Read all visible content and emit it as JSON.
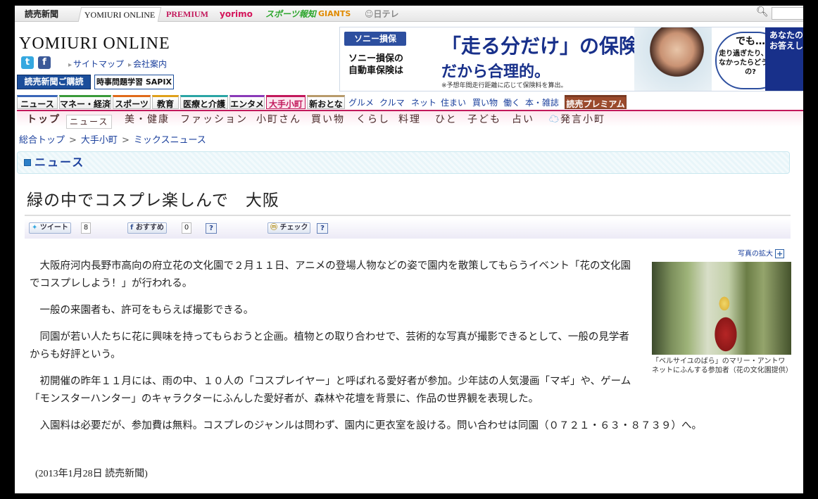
{
  "brand_tabs": [
    "読売新聞",
    "YOMIURI ONLINE",
    "PREMIUM",
    "yorimo",
    "スポーツ報知",
    "GIANTS",
    "日テレ"
  ],
  "header": {
    "logo": "YOMIURI ONLINE",
    "links": [
      "サイトマップ",
      "会社案内"
    ],
    "paper_button": "読売新聞ご購読",
    "sapix_button": "時事問題学習 SAPIX"
  },
  "ad": {
    "logo": "ソニー損保",
    "sub": "ソニー損保の\n自動車保険は",
    "headline": "「走る分だけ」の保険料!",
    "headline2": "だから合理的。",
    "note": "※予想年間走行距離に応じて保険料を算出。",
    "bubble_title": "でも…",
    "bubble_text": "走り過ぎたり、走らなかったらどうなるの?",
    "right": "あなたのお答えし"
  },
  "nav": {
    "tabs": [
      "ニュース",
      "マネー・経済",
      "スポーツ",
      "教育",
      "医療と介護",
      "エンタメ",
      "大手小町",
      "新おとな",
      "読売プレミアム"
    ],
    "sub_links": [
      "グルメ",
      "クルマ",
      "ネット",
      "住まい",
      "買い物",
      "働く",
      "本・雑誌"
    ]
  },
  "subnav": [
    "トップ",
    "ニュース",
    "美・健康",
    "ファッション",
    "小町さん",
    "買い物",
    "くらし",
    "料理",
    "ひと",
    "子ども",
    "占い",
    "発言小町"
  ],
  "breadcrumb": [
    "総合トップ",
    "大手小町",
    "ミックスニュース"
  ],
  "section_title": "ニュース",
  "article": {
    "headline": "緑の中でコスプレ楽しんで　大阪",
    "share": {
      "tweet": "ツイート",
      "tweet_count": "8",
      "fb": "おすすめ",
      "fb_count": "0",
      "check": "チェック",
      "help": "?"
    },
    "paragraphs": [
      "大阪府河内長野市高向の府立花の文化園で２月１１日、アニメの登場人物などの姿で園内を散策してもらうイベント「花の文化園でコスプレしよう！」が行われる。",
      "一般の来園者も、許可をもらえば撮影できる。",
      "同園が若い人たちに花に興味を持ってもらおうと企画。植物との取り合わせで、芸術的な写真が撮影できるとして、一般の見学者からも好評という。",
      "初開催の昨年１１月には、雨の中、１０人の「コスプレイヤー」と呼ばれる愛好者が参加。少年誌の人気漫画「マギ」や、ゲーム「モンスターハンター」のキャラクターにふんした愛好者が、森林や花壇を背景に、作品の世界観を表現した。",
      "入園料は必要だが、参加費は無料。コスプレのジャンルは問わず、園内に更衣室を設ける。問い合わせは同園（０７２１・６３・８７３９）へ。"
    ],
    "dateline": "(2013年1月28日  読売新聞)",
    "photo_zoom": "写真の拡大",
    "photo_caption": "「ベルサイユのばら」のマリー・アントワネットにふんする参加者（花の文化園提供）"
  }
}
